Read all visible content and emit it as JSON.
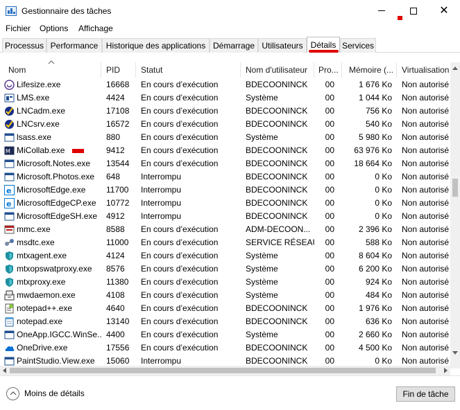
{
  "window": {
    "title": "Gestionnaire des tâches"
  },
  "menu": [
    "Fichier",
    "Options",
    "Affichage"
  ],
  "tabs": [
    "Processus",
    "Performance",
    "Historique des applications",
    "Démarrage",
    "Utilisateurs",
    "Détails",
    "Services"
  ],
  "active_tab": "Détails",
  "columns": [
    "Nom",
    "PID",
    "Statut",
    "Nom d'utilisateur",
    "Pro...",
    "Mémoire (...",
    "Virtualisation ..."
  ],
  "rows": [
    {
      "icon": "lifesize-icon",
      "name": "Lifesize.exe",
      "pid": "16668",
      "status": "En cours d’exécution",
      "user": "BDECOONINCK",
      "cpu": "00",
      "mem": "1 676 Ko",
      "virt": "Non autorisé"
    },
    {
      "icon": "lms-icon",
      "name": "LMS.exe",
      "pid": "4424",
      "status": "En cours d’exécution",
      "user": "Système",
      "cpu": "00",
      "mem": "1 044 Ko",
      "virt": "Non autorisé"
    },
    {
      "icon": "lnc-icon",
      "name": "LNCadm.exe",
      "pid": "17108",
      "status": "En cours d’exécution",
      "user": "BDECOONINCK",
      "cpu": "00",
      "mem": "756 Ko",
      "virt": "Non autorisé"
    },
    {
      "icon": "lnc-icon",
      "name": "LNCsrv.exe",
      "pid": "16572",
      "status": "En cours d’exécution",
      "user": "BDECOONINCK",
      "cpu": "00",
      "mem": "540 Ko",
      "virt": "Non autorisé"
    },
    {
      "icon": "window-icon",
      "name": "lsass.exe",
      "pid": "880",
      "status": "En cours d’exécution",
      "user": "Système",
      "cpu": "00",
      "mem": "5 980 Ko",
      "virt": "Non autorisé"
    },
    {
      "icon": "micollab-icon",
      "name": "MiCollab.exe",
      "pid": "9412",
      "status": "En cours d’exécution",
      "user": "BDECOONINCK",
      "cpu": "00",
      "mem": "63 976 Ko",
      "virt": "Non autorisé"
    },
    {
      "icon": "window-icon",
      "name": "Microsoft.Notes.exe",
      "pid": "13544",
      "status": "En cours d’exécution",
      "user": "BDECOONINCK",
      "cpu": "00",
      "mem": "18 664 Ko",
      "virt": "Non autorisé"
    },
    {
      "icon": "window-icon",
      "name": "Microsoft.Photos.exe",
      "pid": "648",
      "status": "Interrompu",
      "user": "BDECOONINCK",
      "cpu": "00",
      "mem": "0 Ko",
      "virt": "Non autorisé"
    },
    {
      "icon": "edge-icon",
      "name": "MicrosoftEdge.exe",
      "pid": "11700",
      "status": "Interrompu",
      "user": "BDECOONINCK",
      "cpu": "00",
      "mem": "0 Ko",
      "virt": "Non autorisé"
    },
    {
      "icon": "edge-icon",
      "name": "MicrosoftEdgeCP.exe",
      "pid": "10772",
      "status": "Interrompu",
      "user": "BDECOONINCK",
      "cpu": "00",
      "mem": "0 Ko",
      "virt": "Non autorisé"
    },
    {
      "icon": "window-icon",
      "name": "MicrosoftEdgeSH.exe",
      "pid": "4912",
      "status": "Interrompu",
      "user": "BDECOONINCK",
      "cpu": "00",
      "mem": "0 Ko",
      "virt": "Non autorisé"
    },
    {
      "icon": "mmc-icon",
      "name": "mmc.exe",
      "pid": "8588",
      "status": "En cours d’exécution",
      "user": "ADM-DECOON...",
      "cpu": "00",
      "mem": "2 396 Ko",
      "virt": "Non autorisé"
    },
    {
      "icon": "msdtc-icon",
      "name": "msdtc.exe",
      "pid": "11000",
      "status": "En cours d’exécution",
      "user": "SERVICE RÉSEAU",
      "cpu": "00",
      "mem": "588 Ko",
      "virt": "Non autorisé"
    },
    {
      "icon": "shield-icon",
      "name": "mtxagent.exe",
      "pid": "4124",
      "status": "En cours d’exécution",
      "user": "Système",
      "cpu": "00",
      "mem": "8 604 Ko",
      "virt": "Non autorisé"
    },
    {
      "icon": "shield-icon",
      "name": "mtxopswatproxy.exe",
      "pid": "8576",
      "status": "En cours d’exécution",
      "user": "Système",
      "cpu": "00",
      "mem": "6 200 Ko",
      "virt": "Non autorisé"
    },
    {
      "icon": "shield-icon",
      "name": "mtxproxy.exe",
      "pid": "11380",
      "status": "En cours d’exécution",
      "user": "Système",
      "cpu": "00",
      "mem": "924 Ko",
      "virt": "Non autorisé"
    },
    {
      "icon": "daemon-icon",
      "name": "mwdaemon.exe",
      "pid": "4108",
      "status": "En cours d’exécution",
      "user": "Système",
      "cpu": "00",
      "mem": "484 Ko",
      "virt": "Non autorisé"
    },
    {
      "icon": "notepadpp-icon",
      "name": "notepad++.exe",
      "pid": "4640",
      "status": "En cours d’exécution",
      "user": "BDECOONINCK",
      "cpu": "00",
      "mem": "1 976 Ko",
      "virt": "Non autorisé"
    },
    {
      "icon": "notepad-icon",
      "name": "notepad.exe",
      "pid": "13140",
      "status": "En cours d’exécution",
      "user": "BDECOONINCK",
      "cpu": "00",
      "mem": "636 Ko",
      "virt": "Non autorisé"
    },
    {
      "icon": "window-icon",
      "name": "OneApp.IGCC.WinSe...",
      "pid": "4400",
      "status": "En cours d’exécution",
      "user": "Système",
      "cpu": "00",
      "mem": "2 660 Ko",
      "virt": "Non autorisé"
    },
    {
      "icon": "onedrive-icon",
      "name": "OneDrive.exe",
      "pid": "17556",
      "status": "En cours d’exécution",
      "user": "BDECOONINCK",
      "cpu": "00",
      "mem": "4 500 Ko",
      "virt": "Non autorisé"
    },
    {
      "icon": "window-icon",
      "name": "PaintStudio.View.exe",
      "pid": "15060",
      "status": "Interrompu",
      "user": "BDECOONINCK",
      "cpu": "00",
      "mem": "0 Ko",
      "virt": "Non autorisé"
    }
  ],
  "footer": {
    "fewer_details": "Moins de détails",
    "end_task": "Fin de tâche"
  },
  "colors": {
    "highlight_mark": "#e00000",
    "accent": "#0078d7"
  }
}
